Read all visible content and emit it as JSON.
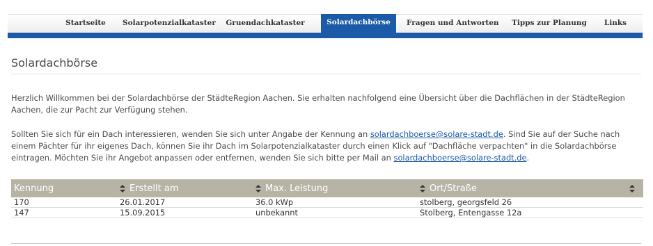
{
  "nav": {
    "items": [
      {
        "label": "Startseite",
        "active": false
      },
      {
        "label": "Solarpotenzialkataster",
        "active": false
      },
      {
        "label": "Gruendachkataster",
        "active": false
      },
      {
        "label": "Solardachbörse",
        "active": true
      },
      {
        "label": "Fragen und Antworten",
        "active": false
      },
      {
        "label": "Tipps zur Planung",
        "active": false
      },
      {
        "label": "Links",
        "active": false
      }
    ]
  },
  "page": {
    "title": "Solardachbörse",
    "intro": "Herzlich Willkommen bei der Solardachbörse der StädteRegion Aachen. Sie erhalten nachfolgend eine Übersicht über die Dachflächen in der StädteRegion Aachen, die zur Pacht zur Verfügung stehen.",
    "contact_pre": "Sollten Sie sich für ein Dach interessieren, wenden Sie sich unter Angabe der Kennung an ",
    "contact_email": "solardachboerse@solare-stadt.de",
    "contact_mid": ". Sind Sie auf der Suche nach einem Pächter für ihr eigenes Dach, können Sie ihr Dach im Solarpotenzialkataster durch einen Klick auf \"Dachfläche verpachten\" in die Solardachbörse eintragen. Möchten Sie ihr Angebot anpassen oder entfernen, wenden Sie sich bitte per Mail an ",
    "contact_email2": "solardachboerse@solare-stadt.de",
    "contact_post": "."
  },
  "table": {
    "columns": [
      "Kennung",
      "Erstellt am",
      "Max. Leistung",
      "Ort/Straße"
    ],
    "rows": [
      [
        "170",
        "26.01.2017",
        "36.0 kWp",
        "stolberg, georgsfeld 26"
      ],
      [
        "147",
        "15.09.2015",
        "unbekannt",
        "Stolberg, Entengasse 12a"
      ]
    ]
  },
  "colors": {
    "accent": "#1b5aa6",
    "header_bg": "#b7b4a6"
  }
}
